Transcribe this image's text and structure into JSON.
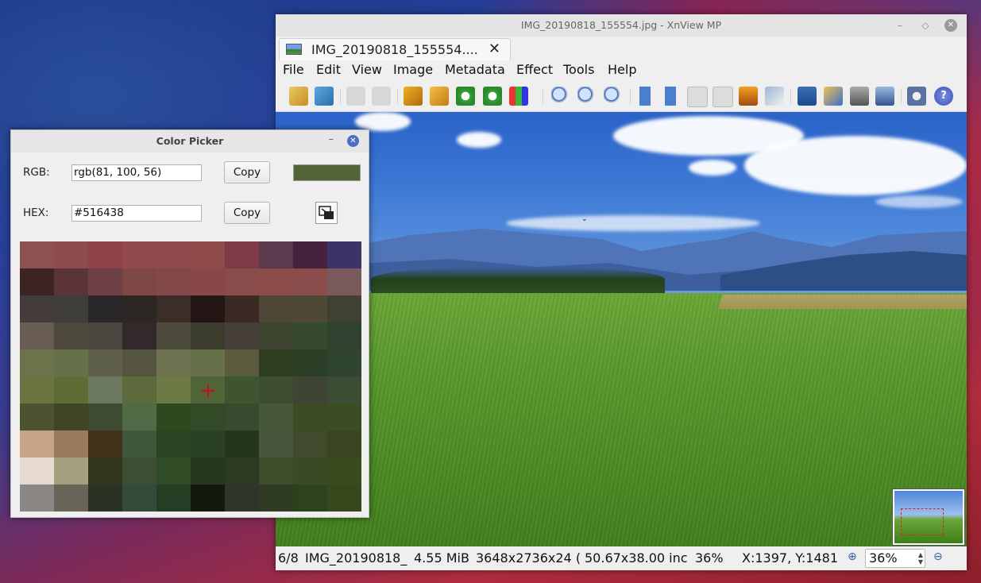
{
  "main_window": {
    "title": "IMG_20190818_155554.jpg - XnView MP",
    "tab_label": "IMG_20190818_155554....",
    "tab_close": "✕",
    "menu": [
      "File",
      "Edit",
      "View",
      "Image",
      "Metadata",
      "Effect",
      "Tools",
      "Help"
    ],
    "window_controls": {
      "minimize": "–",
      "maximize": "◇",
      "close": "✕"
    },
    "toolbar_icons": [
      "browser-icon",
      "save-icon",
      "undo-icon",
      "redo-icon",
      "crop-icon",
      "resize-icon",
      "rotate-left-icon",
      "rotate-right-icon",
      "color-adjust-icon",
      "zoom-in-icon",
      "zoom-fit-icon",
      "zoom-out-icon",
      "previous-icon",
      "next-icon",
      "first-icon",
      "last-icon",
      "slideshow-icon",
      "info-icon",
      "fullscreen-icon",
      "edit-text-icon",
      "print-icon",
      "capture-icon",
      "settings-icon",
      "help-icon"
    ],
    "status": {
      "index": "6/8",
      "filename": "IMG_20190818_",
      "filesize": "4.55 MiB",
      "dimensions": "3648x2736x24 (",
      "physical": "50.67x38.00 inc",
      "zoom_percent": "36%",
      "coords": "X:1397, Y:1481",
      "zoom_value": "36%"
    }
  },
  "color_picker": {
    "title": "Color Picker",
    "rgb_label": "RGB:",
    "rgb_value": "rgb(81, 100, 56)",
    "hex_label": "HEX:",
    "hex_value": "#516438",
    "copy_label": "Copy",
    "minimize": "–",
    "close": "✕",
    "swatch_color": "#516438",
    "zoom_pixels": [
      [
        "#8e5050",
        "#8f4c4c",
        "#8f4548",
        "#904a4d",
        "#8f4a4c",
        "#8f4a4a",
        "#7d3a48",
        "#5c3a4d",
        "#46223f",
        "#3a3566"
      ],
      [
        "#3c2424",
        "#5a3436",
        "#6e3f45",
        "#7d4747",
        "#83484a",
        "#88474b",
        "#8a4b4b",
        "#8b4c4a",
        "#8b4d4b",
        "#7a595d"
      ],
      [
        "#433c3a",
        "#3f3e39",
        "#2a272a",
        "#2c2625",
        "#3b2e28",
        "#231614",
        "#3b2924",
        "#4d4535",
        "#4d4935",
        "#414133"
      ],
      [
        "#695c50",
        "#4d4a3d",
        "#4a4740",
        "#33282a",
        "#4d4b3c",
        "#3d3d2e",
        "#47403a",
        "#3c4430",
        "#354a2f",
        "#2f4330"
      ],
      [
        "#6c7249",
        "#66704a",
        "#5d5f49",
        "#555440",
        "#6c7150",
        "#677149",
        "#5a5a3d",
        "#2f3d20",
        "#2c4028",
        "#2f4530"
      ],
      [
        "#6a7441",
        "#5e6c36",
        "#6c7860",
        "#5c6a3c",
        "#6c7a45",
        "#516438",
        "#3f5530",
        "#3d4d30",
        "#3e4532",
        "#3b4d32"
      ],
      [
        "#4d5230",
        "#424426",
        "#3e4a31",
        "#506b45",
        "#2f481e",
        "#334a26",
        "#384b2f",
        "#47583a",
        "#3c4b24",
        "#3e4c24"
      ],
      [
        "#c7a486",
        "#9b7b60",
        "#3f3218",
        "#40573a",
        "#2b4323",
        "#2a4124",
        "#23351c",
        "#48573b",
        "#414a2d",
        "#3a4522"
      ],
      [
        "#e6dace",
        "#a3a07d",
        "#33361c",
        "#3d4f32",
        "#304c27",
        "#26381f",
        "#2c3a24",
        "#3e4c29",
        "#3a4a24",
        "#3a4b1e"
      ],
      [
        "#8a8784",
        "#686457",
        "#2c3223",
        "#344a3a",
        "#273c24",
        "#121a0e",
        "#2d3628",
        "#303b24",
        "#2e421e",
        "#36481c"
      ]
    ]
  }
}
